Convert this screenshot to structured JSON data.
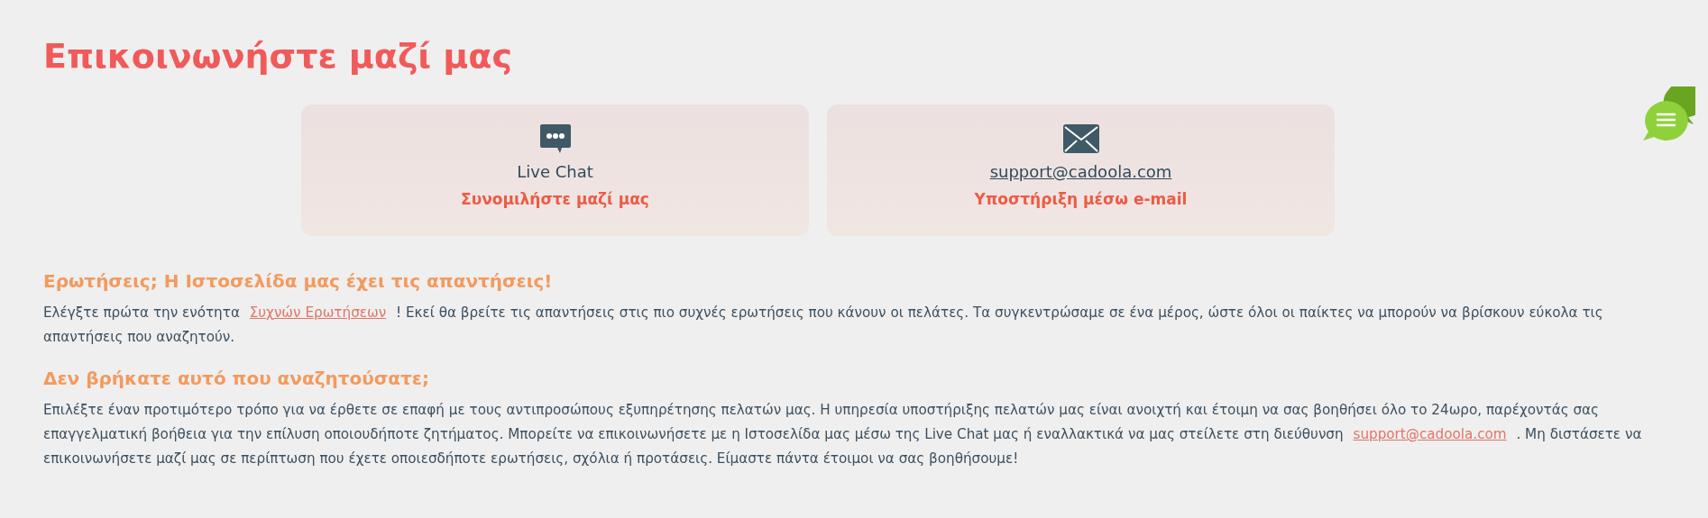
{
  "title": "Επικοινωνήστε μαζί μας",
  "cards": [
    {
      "kind": "chat",
      "label": "Live Chat",
      "caption": "Συνομιλήστε μαζί μας"
    },
    {
      "kind": "email",
      "label": "support@cadoola.com",
      "caption": "Υποστήριξη μέσω e-mail"
    }
  ],
  "sections": [
    {
      "heading": "Ερωτήσεις; Η Ιστοσελίδα μας έχει τις απαντήσεις!",
      "text_before": "Ελέγξτε πρώτα την ενότητα",
      "link": "Συχνών Ερωτήσεων",
      "text_after": "! Εκεί θα βρείτε τις απαντήσεις στις πιο συχνές ερωτήσεις που κάνουν οι πελάτες. Τα συγκεντρώσαμε σε ένα μέρος, ώστε όλοι οι παίκτες να μπορούν να βρίσκουν εύκολα τις απαντήσεις που αναζητούν."
    },
    {
      "heading": "Δεν βρήκατε αυτό που αναζητούσατε;",
      "text_before": "Επιλέξτε έναν προτιμότερο τρόπο για να έρθετε σε επαφή με τους αντιπροσώπους εξυπηρέτησης πελατών μας. Η υπηρεσία υποστήριξης πελατών μας είναι ανοιχτή και έτοιμη να σας βοηθήσει όλο το 24ωρο, παρέχοντάς σας επαγγελματική βοήθεια για την επίλυση οποιουδήποτε ζητήματος. Μπορείτε να επικοινωνήσετε με η Ιστοσελίδα μας μέσω της Live Chat μας ή εναλλακτικά να μας στείλετε στη διεύθυνση",
      "link": "support@cadoola.com",
      "text_after": ". Μη διστάσετε να επικοινωνήσετε μαζί μας σε περίπτωση που έχετε οποιεσδήποτε ερωτήσεις, σχόλια ή προτάσεις. Είμαστε πάντα έτοιμοι να σας βοηθήσουμε!"
    }
  ]
}
